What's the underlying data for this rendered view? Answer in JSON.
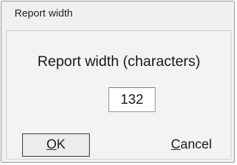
{
  "dialog": {
    "title": "Report width",
    "prompt": "Report width (characters)",
    "width_value": "132",
    "ok": {
      "mnemonic": "O",
      "rest": "K"
    },
    "cancel": {
      "mnemonic": "C",
      "rest": "ancel"
    }
  }
}
